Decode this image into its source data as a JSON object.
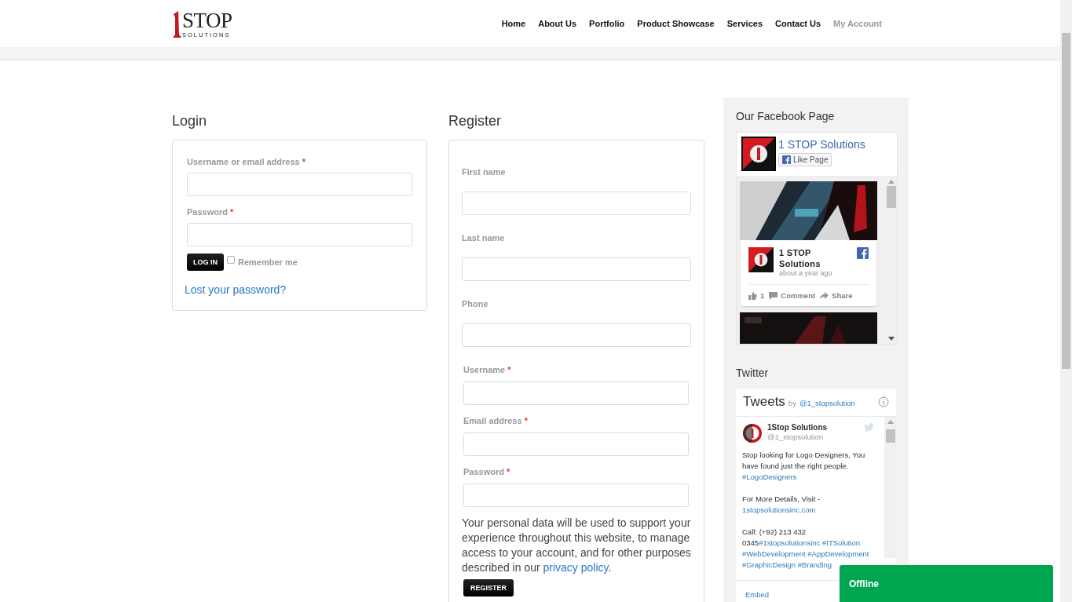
{
  "header": {
    "logo": {
      "word": "STOP",
      "tagline": "SOLUTIONS"
    },
    "nav": [
      {
        "label": "Home",
        "selected": false
      },
      {
        "label": "About Us",
        "selected": false
      },
      {
        "label": "Portfolio",
        "selected": false
      },
      {
        "label": "Product Showcase",
        "selected": false
      },
      {
        "label": "Services",
        "selected": false
      },
      {
        "label": "Contact Us",
        "selected": false
      },
      {
        "label": "My Account",
        "selected": true
      }
    ]
  },
  "login": {
    "title": "Login",
    "fields": [
      {
        "label": "Username or email address",
        "required": "*"
      },
      {
        "label": "Password",
        "required": "*"
      }
    ],
    "button": "LOG IN",
    "remember": {
      "label": "Remember me",
      "checked": false
    },
    "lost_password": "Lost your password?"
  },
  "register": {
    "title": "Register",
    "fields": [
      {
        "label": "First name",
        "kind": "extra"
      },
      {
        "label": "Last name",
        "kind": "extra"
      },
      {
        "label": "Phone",
        "kind": "extra"
      },
      {
        "label": "Username",
        "required": "*",
        "kind": "core"
      },
      {
        "label": "Email address",
        "required": "*",
        "kind": "core"
      },
      {
        "label": "Password",
        "required": "*",
        "kind": "core"
      }
    ],
    "privacy": {
      "text": "Your personal data will be used to support your experience throughout this website, to manage access to your account, and for other purposes described in our ",
      "link": "privacy policy",
      "end": "."
    },
    "button": "REGISTER"
  },
  "sidebar": {
    "facebook": {
      "title": "Our Facebook Page",
      "page_name": "1 STOP Solutions",
      "like": "Like Page",
      "post": {
        "author": "1 STOP Solutions",
        "time": "about a year ago",
        "likes": "1",
        "comment": "Comment",
        "share": "Share"
      }
    },
    "twitter": {
      "title": "Twitter",
      "header": "Tweets",
      "by": "by",
      "handle": "@1_stopsolution",
      "tweet": {
        "author": "1Stop Solutions",
        "handle": "@1_stopsolution",
        "paragraphs": [
          [
            {
              "kind": "text",
              "text": "Stop looking for Logo Designers, You have found just the right people. "
            },
            {
              "kind": "link",
              "text": "#LogoDesigners"
            }
          ],
          [
            {
              "kind": "text",
              "text": "For More Details, Visit - "
            },
            {
              "kind": "link",
              "text": "1stopsolutionsinc.com"
            }
          ],
          [
            {
              "kind": "text",
              "text": "Call: (+92) 213 432 0345"
            },
            {
              "kind": "link",
              "text": "#1stopsolutionsinc"
            },
            {
              "kind": "link",
              "text": "#ITSolution"
            },
            {
              "kind": "link",
              "text": "#WebDevelopment"
            },
            {
              "kind": "link",
              "text": "#AppDevelopment"
            },
            {
              "kind": "link",
              "text": "#GraphicDesign"
            },
            {
              "kind": "link",
              "text": "#Branding"
            }
          ]
        ]
      },
      "footer_link": "Embed"
    }
  },
  "chat": {
    "status": "Offline"
  }
}
